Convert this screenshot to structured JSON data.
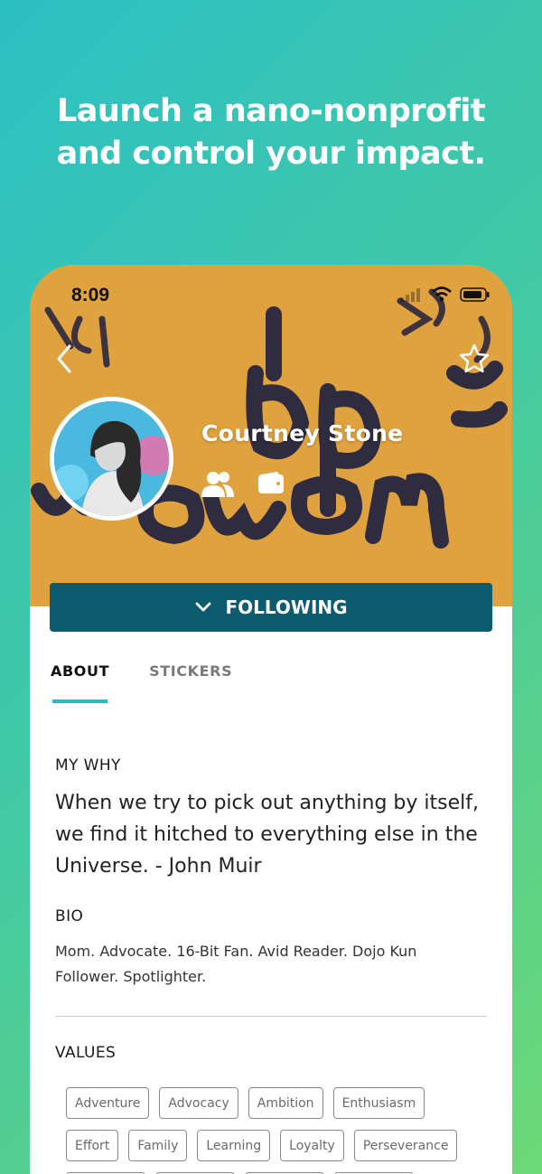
{
  "headline": {
    "line1": "Launch a nano-nonprofit",
    "line2": "and control your impact."
  },
  "status_bar": {
    "time": "8:09"
  },
  "profile": {
    "name": "Courtney Stone",
    "follow_label": "FOLLOWING"
  },
  "tabs": [
    {
      "label": "ABOUT",
      "active": true
    },
    {
      "label": "STICKERS",
      "active": false
    }
  ],
  "about": {
    "why_label": "MY WHY",
    "why_text": "When we try to pick out anything by itself, we find it hitched to everything else in the Universe. - John Muir",
    "bio_label": "BIO",
    "bio_text": "Mom. Advocate. 16-Bit Fan. Avid Reader. Dojo Kun Follower. Spotlighter.",
    "values_label": "VALUES",
    "values": [
      [
        "Adventure",
        "Advocacy",
        "Ambition",
        "Enthusiasm"
      ],
      [
        "Effort",
        "Family",
        "Learning",
        "Loyalty",
        "Perseverance"
      ]
    ]
  },
  "icons": {
    "back": "chevron-left-icon",
    "favorite": "star-icon",
    "community": "people-icon",
    "wallet": "wallet-icon",
    "follow_chevron": "chevron-down-icon"
  },
  "colors": {
    "accent": "#2bb6c0",
    "follow_button": "#0c5b6e",
    "cover": "#e0a13f"
  }
}
